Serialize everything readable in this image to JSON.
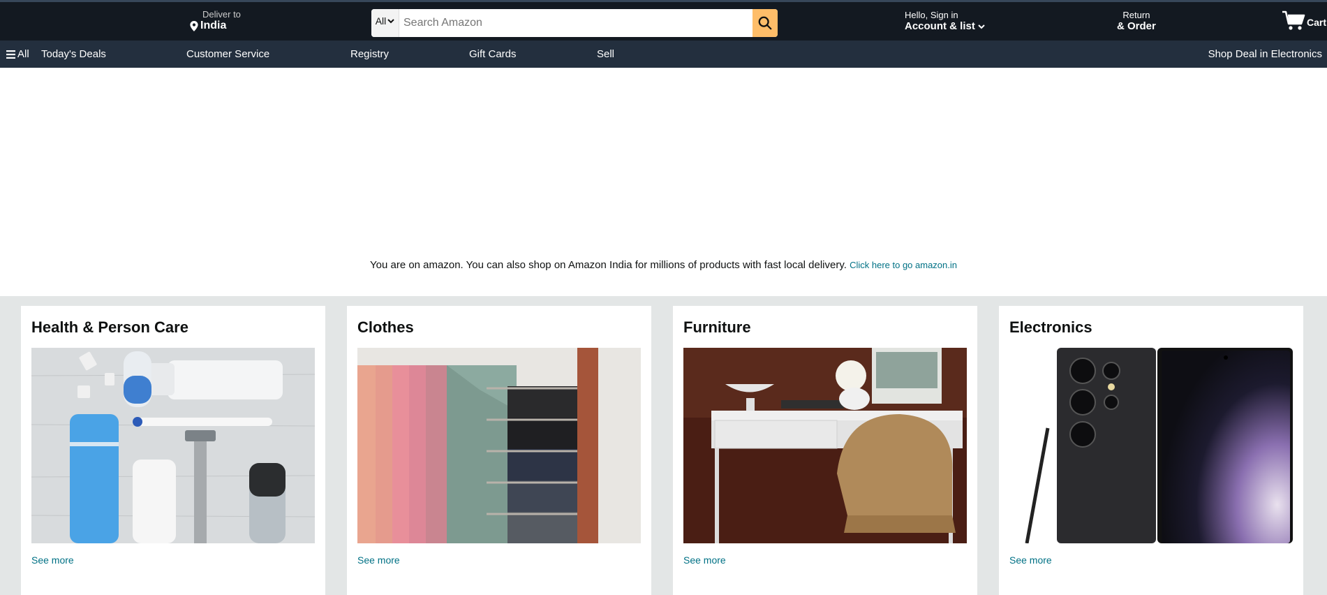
{
  "header": {
    "deliver_small": "Deliver to",
    "deliver_location": "India",
    "search_category": "All",
    "search_placeholder": "Search Amazon",
    "account_small": "Hello, Sign in",
    "account_big": "Account & list",
    "returns_small": "Return",
    "returns_big": "& Order",
    "cart_label": "Cart"
  },
  "nav": {
    "all": "All",
    "items": [
      "Today's Deals",
      "Customer Service",
      "Registry",
      "Gift Cards",
      "Sell"
    ],
    "right": "Shop Deal in Electronics"
  },
  "notice": {
    "text": "You are on amazon. You can also shop on Amazon India for millions of products with fast local delivery.",
    "link": "Click here to go amazon.in"
  },
  "cards": [
    {
      "title": "Health & Person Care",
      "link": "See more"
    },
    {
      "title": "Clothes",
      "link": "See more"
    },
    {
      "title": "Furniture",
      "link": "See more"
    },
    {
      "title": "Electronics",
      "link": "See more"
    }
  ],
  "colors": {
    "header_bg": "#131921",
    "nav_bg": "#232f3e",
    "search_button": "#febd69",
    "link": "#007185",
    "page_bg": "#e3e6e6"
  }
}
